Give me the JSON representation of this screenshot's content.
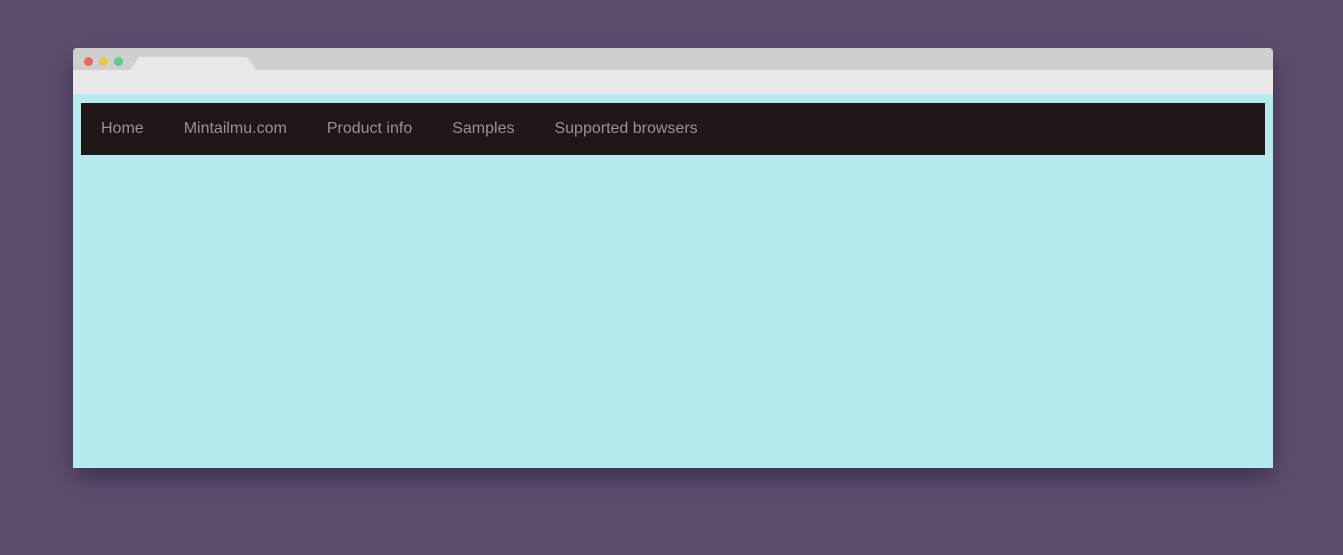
{
  "window_controls": {
    "close_color": "#e9695c",
    "minimize_color": "#e8c93b",
    "maximize_color": "#5ccd8a"
  },
  "colors": {
    "page_background": "#5e4e6e",
    "content_background": "#b5ebef",
    "navbar_background": "#201716",
    "nav_link_color": "#9a9191"
  },
  "nav": {
    "items": [
      {
        "label": "Home"
      },
      {
        "label": "Mintailmu.com"
      },
      {
        "label": "Product info"
      },
      {
        "label": "Samples"
      },
      {
        "label": "Supported browsers"
      }
    ]
  }
}
